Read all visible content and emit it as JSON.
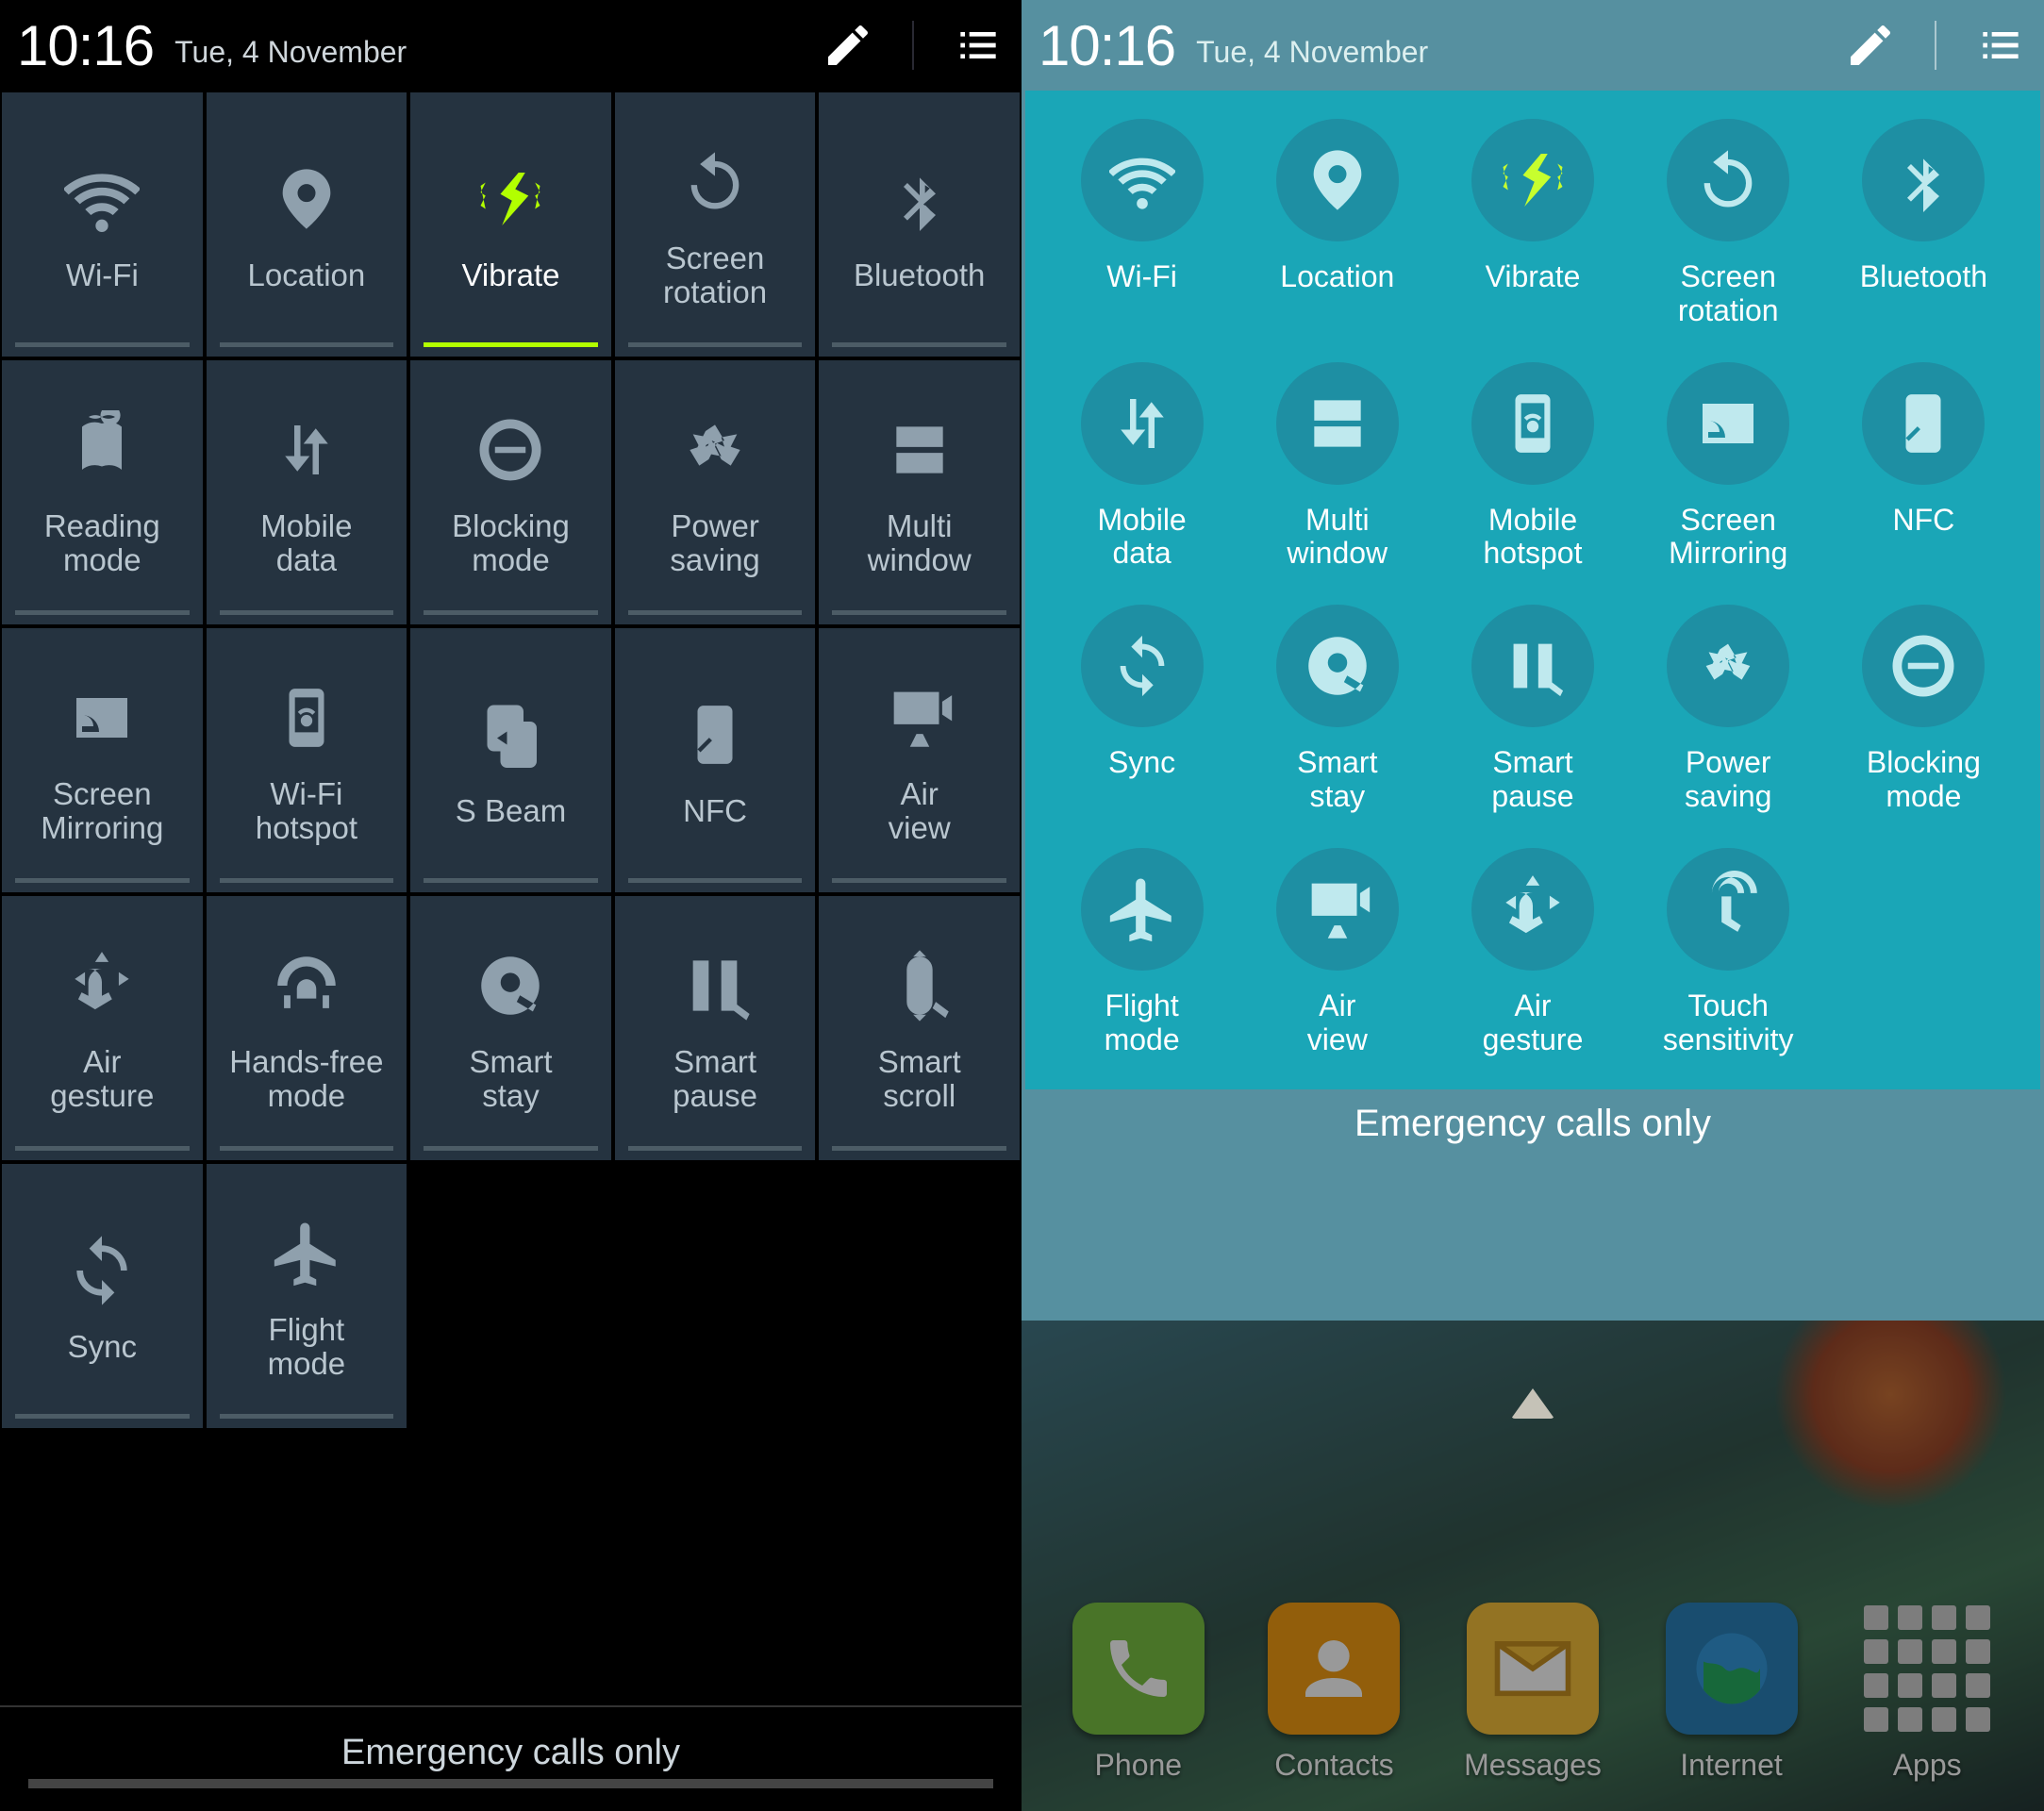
{
  "header": {
    "time": "10:16",
    "date": "Tue, 4 November"
  },
  "left": {
    "tiles": [
      {
        "label": "Wi-Fi",
        "icon": "wifi",
        "active": false
      },
      {
        "label": "Location",
        "icon": "location",
        "active": false
      },
      {
        "label": "Vibrate",
        "icon": "vibrate",
        "active": true
      },
      {
        "label": "Screen\nrotation",
        "icon": "rotation",
        "active": false
      },
      {
        "label": "Bluetooth",
        "icon": "bluetooth",
        "active": false
      },
      {
        "label": "Reading\nmode",
        "icon": "reading",
        "active": false
      },
      {
        "label": "Mobile\ndata",
        "icon": "mobiledata",
        "active": false
      },
      {
        "label": "Blocking\nmode",
        "icon": "blocking",
        "active": false
      },
      {
        "label": "Power\nsaving",
        "icon": "recycle",
        "active": false
      },
      {
        "label": "Multi\nwindow",
        "icon": "multiwindow",
        "active": false
      },
      {
        "label": "Screen\nMirroring",
        "icon": "mirroring",
        "active": false
      },
      {
        "label": "Wi-Fi\nhotspot",
        "icon": "hotspot",
        "active": false
      },
      {
        "label": "S Beam",
        "icon": "sbeam",
        "active": false
      },
      {
        "label": "NFC",
        "icon": "nfc",
        "active": false
      },
      {
        "label": "Air\nview",
        "icon": "airview",
        "active": false
      },
      {
        "label": "Air\ngesture",
        "icon": "airgesture",
        "active": false
      },
      {
        "label": "Hands-free\nmode",
        "icon": "handsfree",
        "active": false
      },
      {
        "label": "Smart\nstay",
        "icon": "smartstay",
        "active": false
      },
      {
        "label": "Smart\npause",
        "icon": "smartpause",
        "active": false
      },
      {
        "label": "Smart\nscroll",
        "icon": "smartscroll",
        "active": false
      },
      {
        "label": "Sync",
        "icon": "sync",
        "active": false
      },
      {
        "label": "Flight\nmode",
        "icon": "flight",
        "active": false
      }
    ],
    "emergency": "Emergency calls only"
  },
  "right": {
    "tiles": [
      {
        "label": "Wi-Fi",
        "icon": "wifi",
        "active": false
      },
      {
        "label": "Location",
        "icon": "location",
        "active": false
      },
      {
        "label": "Vibrate",
        "icon": "vibrate",
        "active": true
      },
      {
        "label": "Screen\nrotation",
        "icon": "rotation",
        "active": false
      },
      {
        "label": "Bluetooth",
        "icon": "bluetooth",
        "active": false
      },
      {
        "label": "Mobile\ndata",
        "icon": "mobiledata",
        "active": false
      },
      {
        "label": "Multi\nwindow",
        "icon": "multiwindow",
        "active": false
      },
      {
        "label": "Mobile\nhotspot",
        "icon": "hotspot",
        "active": false
      },
      {
        "label": "Screen\nMirroring",
        "icon": "mirroring",
        "active": false
      },
      {
        "label": "NFC",
        "icon": "nfc",
        "active": false
      },
      {
        "label": "Sync",
        "icon": "sync",
        "active": false
      },
      {
        "label": "Smart\nstay",
        "icon": "smartstay",
        "active": false
      },
      {
        "label": "Smart\npause",
        "icon": "smartpause",
        "active": false
      },
      {
        "label": "Power\nsaving",
        "icon": "recycle",
        "active": false
      },
      {
        "label": "Blocking\nmode",
        "icon": "blocking",
        "active": false
      },
      {
        "label": "Flight\nmode",
        "icon": "flight",
        "active": false
      },
      {
        "label": "Air\nview",
        "icon": "airview",
        "active": false
      },
      {
        "label": "Air\ngesture",
        "icon": "airgesture",
        "active": false
      },
      {
        "label": "Touch\nsensitivity",
        "icon": "touch",
        "active": false
      }
    ],
    "emergency": "Emergency calls only"
  },
  "dock": [
    {
      "label": "Phone",
      "icon": "phone",
      "bg": "#7ac142"
    },
    {
      "label": "Contacts",
      "icon": "contacts",
      "bg": "#f39c12"
    },
    {
      "label": "Messages",
      "icon": "messages",
      "bg": "#f5c03a"
    },
    {
      "label": "Internet",
      "icon": "internet",
      "bg": "#2980b9"
    },
    {
      "label": "Apps",
      "icon": "apps",
      "bg": "transparent"
    }
  ]
}
